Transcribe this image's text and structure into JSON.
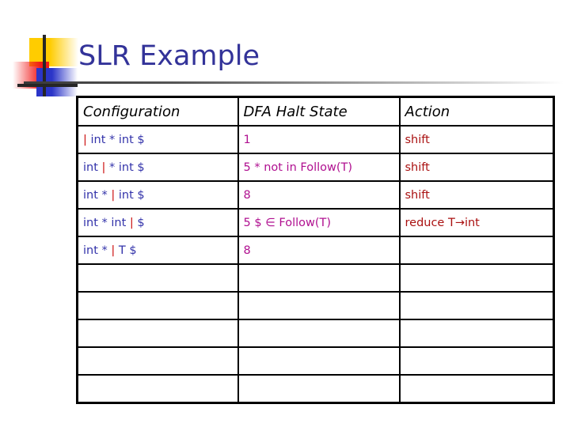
{
  "slide": {
    "title": "SLR Example",
    "title_color": "#333399",
    "logo": {
      "name": "powerpoint-squares-logo",
      "colors": {
        "yellow": "#FFCC00",
        "red": "#F01818",
        "blue": "#2B35C8",
        "line": "#262626"
      }
    }
  },
  "colors": {
    "configuration_text": "#3333AA",
    "cursor_marker": "#CC1111",
    "state_text": "#B01090",
    "action_text": "#AA1111",
    "border": "#000000",
    "background": "#FFFFFF"
  },
  "table": {
    "name": "slr-parse-trace-table",
    "headers": [
      "Configuration",
      "DFA Halt State",
      "Action"
    ],
    "rows": [
      {
        "configuration_pre": "",
        "marker": "|",
        "configuration_post": " int * int $",
        "state": "1",
        "action": "shift"
      },
      {
        "configuration_pre": "int ",
        "marker": "|",
        "configuration_post": " * int $",
        "state": "5  * not in Follow(T)",
        "action": "shift"
      },
      {
        "configuration_pre": "int * ",
        "marker": "|",
        "configuration_post": " int $",
        "state": "8",
        "action": "shift"
      },
      {
        "configuration_pre": "int * int ",
        "marker": "|",
        "configuration_post": " $",
        "state": "5   $ ∈ Follow(T)",
        "action": "reduce T→int"
      },
      {
        "configuration_pre": "int * ",
        "marker": "|",
        "configuration_post": " T $",
        "state": "8",
        "action": ""
      },
      {
        "configuration_pre": "",
        "marker": "",
        "configuration_post": "",
        "state": "",
        "action": ""
      },
      {
        "configuration_pre": "",
        "marker": "",
        "configuration_post": "",
        "state": "",
        "action": ""
      },
      {
        "configuration_pre": "",
        "marker": "",
        "configuration_post": "",
        "state": "",
        "action": ""
      },
      {
        "configuration_pre": "",
        "marker": "",
        "configuration_post": "",
        "state": "",
        "action": ""
      },
      {
        "configuration_pre": "",
        "marker": "",
        "configuration_post": "",
        "state": "",
        "action": ""
      }
    ]
  }
}
